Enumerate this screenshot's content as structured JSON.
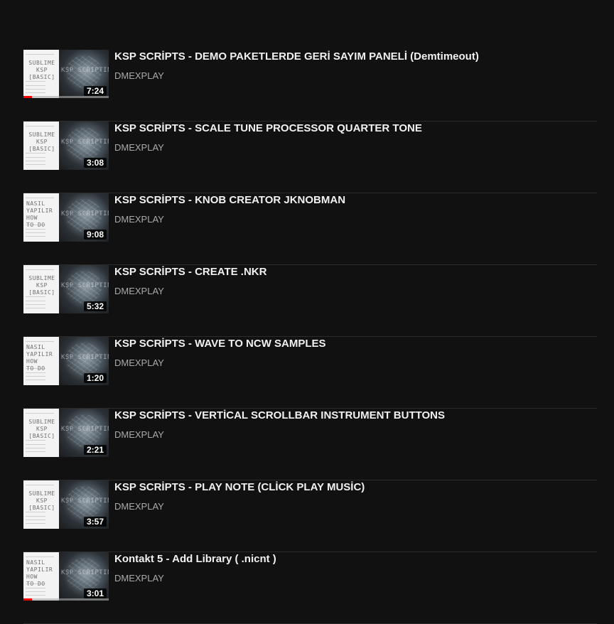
{
  "colors": {
    "background": "#111111",
    "title": "#f1f1f1",
    "channel": "#aaaaaa",
    "progress": "#ff0000"
  },
  "videos": [
    {
      "title": "KSP SCRİPTS - DEMO PAKETLERDE GERİ SAYIM PANELİ (Demtimeout)",
      "channel": "DMEXPLAY",
      "duration": "7:24",
      "thumb_words": [
        "SUBLIME",
        "KSP",
        "[BASIC]"
      ],
      "thumb_art_label": "KSP SCRIPTING",
      "watched_fraction": 0.1
    },
    {
      "title": "KSP SCRİPTS - SCALE TUNE PROCESSOR QUARTER TONE",
      "channel": "DMEXPLAY",
      "duration": "3:08",
      "thumb_words": [
        "SUBLIME",
        "KSP",
        "[BASIC]"
      ],
      "thumb_art_label": "KSP SCRIPTING",
      "watched_fraction": 0
    },
    {
      "title": "KSP SCRİPTS - KNOB CREATOR JKNOBMAN",
      "channel": "DMEXPLAY",
      "duration": "9:08",
      "thumb_words": [
        "NASIL",
        "YAPILIR",
        "HOW",
        "TO DO"
      ],
      "thumb_art_label": "KSP SCRIPTING",
      "watched_fraction": 0
    },
    {
      "title": "KSP SCRİPTS - CREATE .NKR",
      "channel": "DMEXPLAY",
      "duration": "5:32",
      "thumb_words": [
        "SUBLIME",
        "KSP",
        "[BASIC]"
      ],
      "thumb_art_label": "KSP SCRIPTING",
      "watched_fraction": 0
    },
    {
      "title": "KSP SCRİPTS - WAVE TO NCW SAMPLES",
      "channel": "DMEXPLAY",
      "duration": "1:20",
      "thumb_words": [
        "NASIL",
        "YAPILIR",
        "HOW",
        "TO DO"
      ],
      "thumb_art_label": "KSP SCRIPTING",
      "watched_fraction": 0
    },
    {
      "title": "KSP SCRİPTS - VERTİCAL SCROLLBAR INSTRUMENT BUTTONS",
      "channel": "DMEXPLAY",
      "duration": "2:21",
      "thumb_words": [
        "SUBLIME",
        "KSP",
        "[BASIC]"
      ],
      "thumb_art_label": "KSP SCRIPTING",
      "watched_fraction": 0
    },
    {
      "title": "KSP SCRİPTS - PLAY NOTE (CLİCK PLAY MUSİC)",
      "channel": "DMEXPLAY",
      "duration": "3:57",
      "thumb_words": [
        "SUBLIME",
        "KSP",
        "[BASIC]"
      ],
      "thumb_art_label": "KSP SCRIPTING",
      "watched_fraction": 0
    },
    {
      "title": "Kontakt 5 - Add Library ( .nicnt )",
      "channel": "DMEXPLAY",
      "duration": "3:01",
      "thumb_words": [
        "NASIL",
        "YAPILIR",
        "HOW",
        "TO DO"
      ],
      "thumb_art_label": "KSP SCRIPTING",
      "watched_fraction": 0.1
    }
  ]
}
